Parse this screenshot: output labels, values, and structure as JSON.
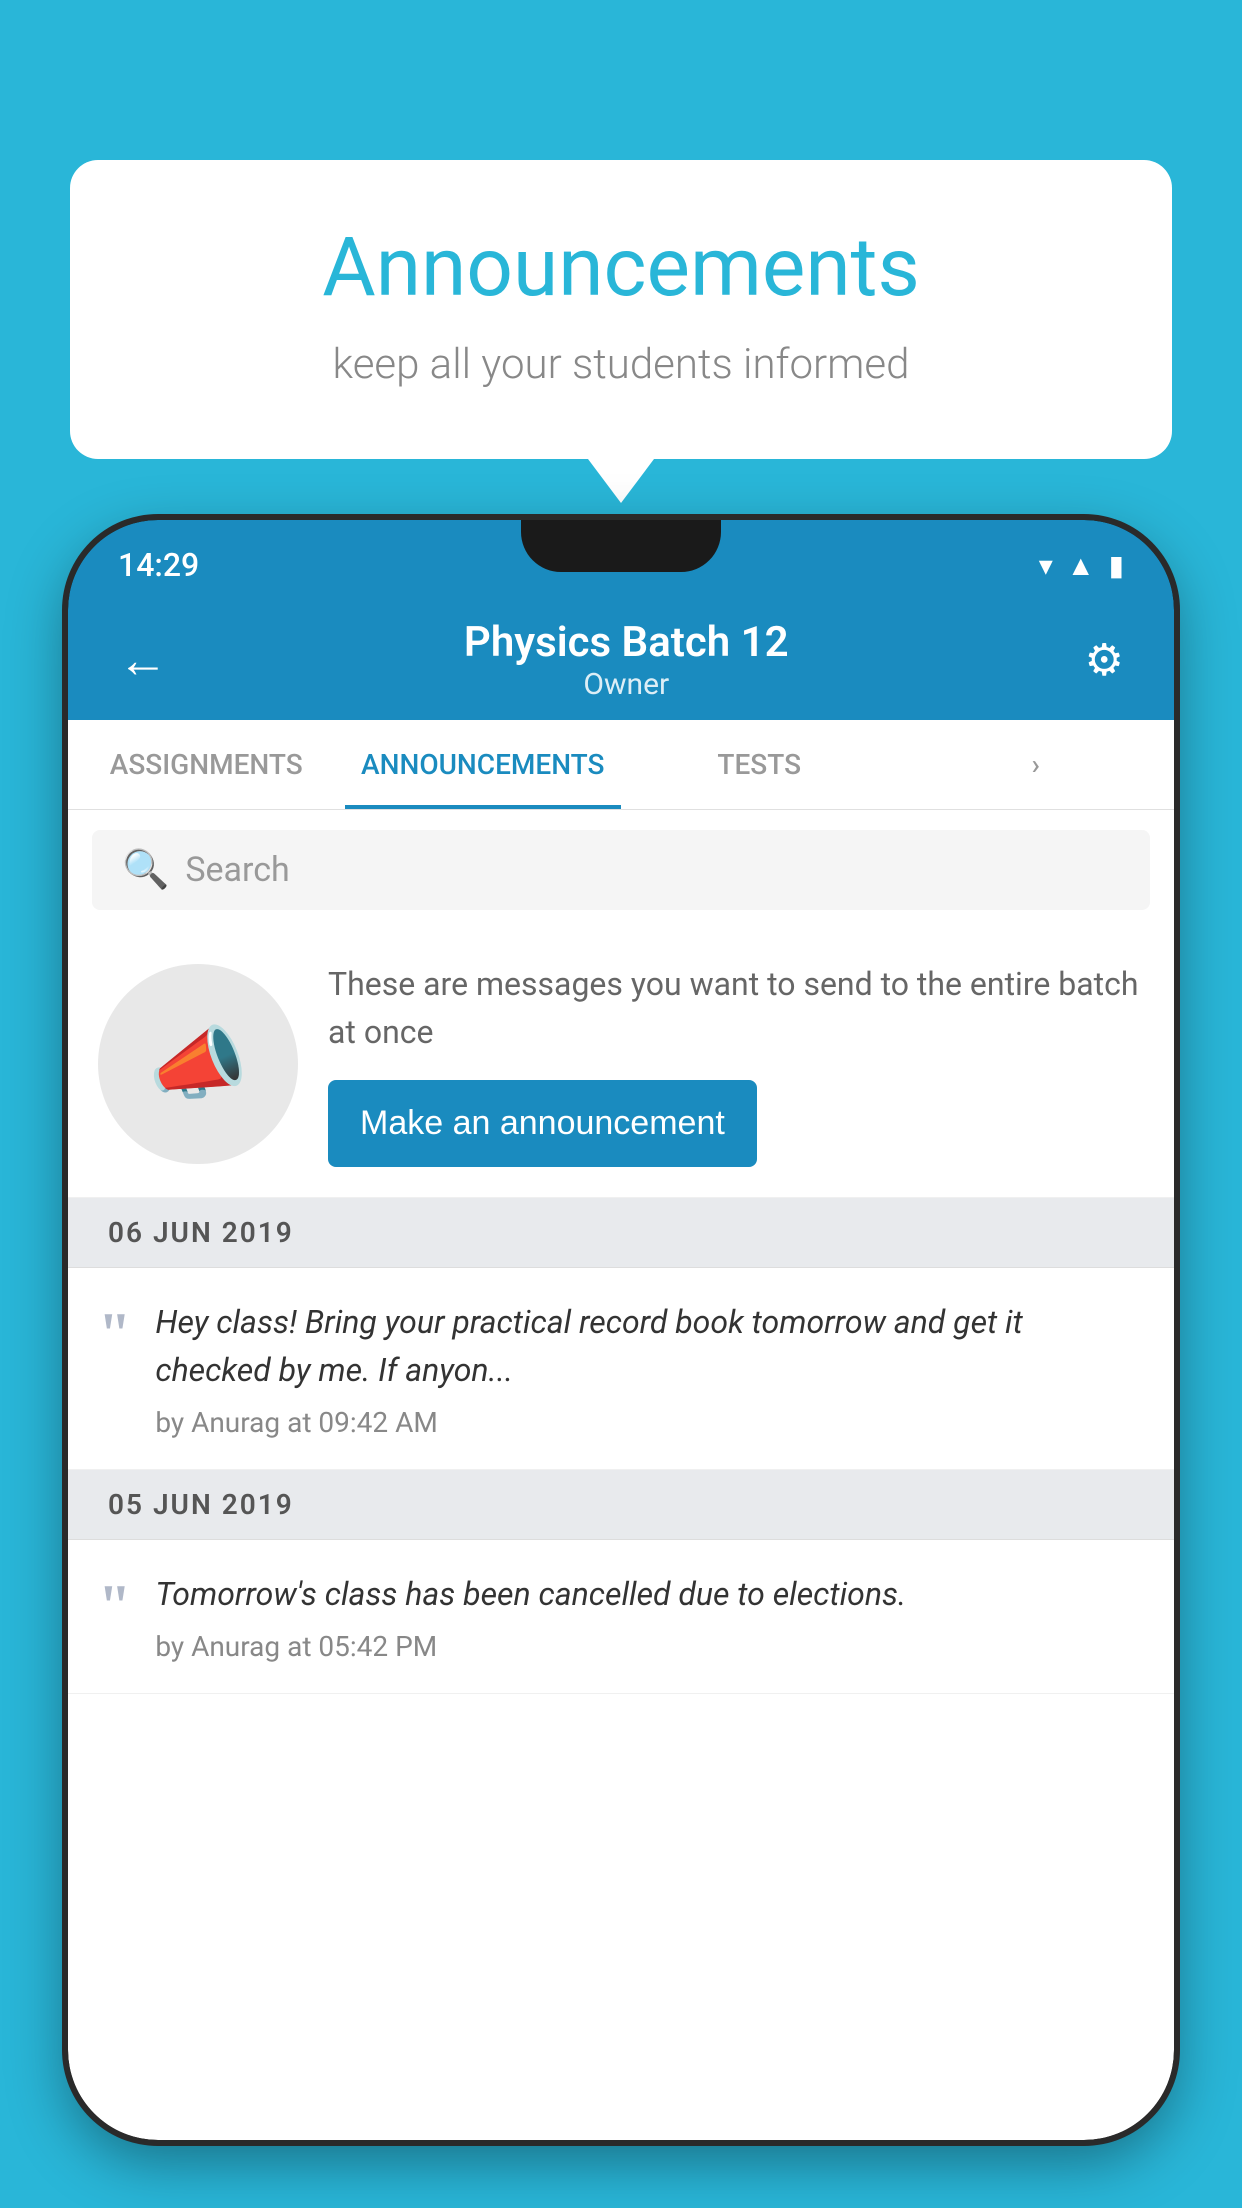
{
  "background_color": "#29B6D8",
  "bubble": {
    "title": "Announcements",
    "subtitle": "keep all your students informed"
  },
  "status_bar": {
    "time": "14:29",
    "icons": [
      "wifi",
      "signal",
      "battery"
    ]
  },
  "app_bar": {
    "title": "Physics Batch 12",
    "subtitle": "Owner",
    "back_label": "←",
    "settings_label": "⚙"
  },
  "tabs": [
    {
      "label": "ASSIGNMENTS",
      "active": false
    },
    {
      "label": "ANNOUNCEMENTS",
      "active": true
    },
    {
      "label": "TESTS",
      "active": false
    },
    {
      "label": "...",
      "active": false
    }
  ],
  "search": {
    "placeholder": "Search"
  },
  "promo": {
    "text": "These are messages you want to send to the entire batch at once",
    "button_label": "Make an announcement"
  },
  "announcements": [
    {
      "date": "06  JUN  2019",
      "text": "Hey class! Bring your practical record book tomorrow and get it checked by me. If anyon...",
      "meta": "by Anurag at 09:42 AM"
    },
    {
      "date": "05  JUN  2019",
      "text": "Tomorrow's class has been cancelled due to elections.",
      "meta": "by Anurag at 05:42 PM"
    }
  ]
}
